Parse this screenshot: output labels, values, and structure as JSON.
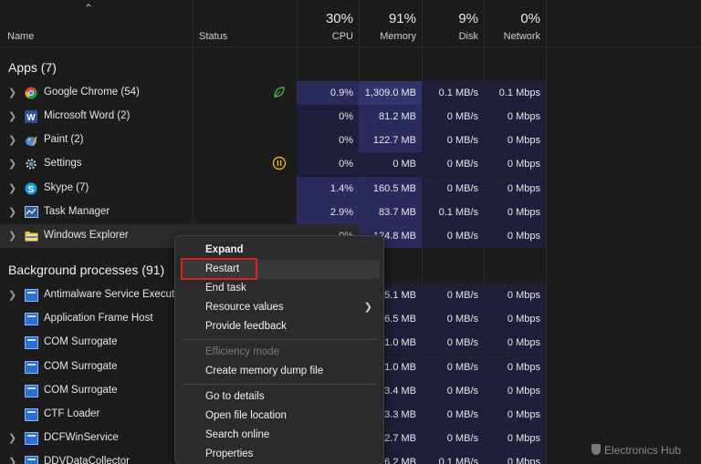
{
  "header": {
    "name_label": "Name",
    "status_label": "Status",
    "cpu": {
      "pct": "30%",
      "label": "CPU"
    },
    "memory": {
      "pct": "91%",
      "label": "Memory"
    },
    "disk": {
      "pct": "9%",
      "label": "Disk"
    },
    "network": {
      "pct": "0%",
      "label": "Network"
    }
  },
  "apps": {
    "title": "Apps (7)",
    "rows": [
      {
        "name": "Google Chrome (54)",
        "cpu": "0.9%",
        "memory": "1,309.0 MB",
        "disk": "0.1 MB/s",
        "network": "0.1 Mbps",
        "icon": "chrome-icon",
        "status_icon": "efficiency-leaf-icon"
      },
      {
        "name": "Microsoft Word (2)",
        "cpu": "0%",
        "memory": "81.2 MB",
        "disk": "0 MB/s",
        "network": "0 Mbps",
        "icon": "word-icon"
      },
      {
        "name": "Paint (2)",
        "cpu": "0%",
        "memory": "122.7 MB",
        "disk": "0 MB/s",
        "network": "0 Mbps",
        "icon": "paint-icon"
      },
      {
        "name": "Settings",
        "cpu": "0%",
        "memory": "0 MB",
        "disk": "0 MB/s",
        "network": "0 Mbps",
        "icon": "settings-gear-icon",
        "status_icon": "suspended-pause-icon"
      },
      {
        "name": "Skype (7)",
        "cpu": "1.4%",
        "memory": "160.5 MB",
        "disk": "0 MB/s",
        "network": "0 Mbps",
        "icon": "skype-icon"
      },
      {
        "name": "Task Manager",
        "cpu": "2.9%",
        "memory": "83.7 MB",
        "disk": "0.1 MB/s",
        "network": "0 Mbps",
        "icon": "task-manager-icon"
      },
      {
        "name": "Windows Explorer",
        "cpu": "0%",
        "memory": "124.8 MB",
        "disk": "0 MB/s",
        "network": "0 Mbps",
        "icon": "folder-icon"
      }
    ]
  },
  "background": {
    "title": "Background processes (91)",
    "rows": [
      {
        "name": "Antimalware Service Executable",
        "memory": "5.1 MB",
        "disk": "0 MB/s",
        "network": "0 Mbps"
      },
      {
        "name": "Application Frame Host",
        "memory": "6.5 MB",
        "disk": "0 MB/s",
        "network": "0 Mbps"
      },
      {
        "name": "COM Surrogate",
        "memory": "1.0 MB",
        "disk": "0 MB/s",
        "network": "0 Mbps"
      },
      {
        "name": "COM Surrogate",
        "memory": "1.0 MB",
        "disk": "0 MB/s",
        "network": "0 Mbps"
      },
      {
        "name": "COM Surrogate",
        "memory": "3.4 MB",
        "disk": "0 MB/s",
        "network": "0 Mbps"
      },
      {
        "name": "CTF Loader",
        "memory": "3.3 MB",
        "disk": "0 MB/s",
        "network": "0 Mbps"
      },
      {
        "name": "DCFWinService",
        "memory": "2.7 MB",
        "disk": "0 MB/s",
        "network": "0 Mbps"
      },
      {
        "name": "DDVDataCollector",
        "memory": "6.2 MB",
        "disk": "0.1 MB/s",
        "network": "0 Mbps"
      }
    ]
  },
  "context_menu": {
    "items": [
      "Expand",
      "Restart",
      "End task",
      "Resource values",
      "Provide feedback",
      "Efficiency mode",
      "Create memory dump file",
      "Go to details",
      "Open file location",
      "Search online",
      "Properties"
    ],
    "highlighted": "Restart",
    "disabled": "Efficiency mode"
  },
  "watermark": "Electronics Hub",
  "colors": {
    "highlight_box": "#e0201c",
    "heat_low": "#1f1f3c",
    "heat_high": "#33336e"
  }
}
